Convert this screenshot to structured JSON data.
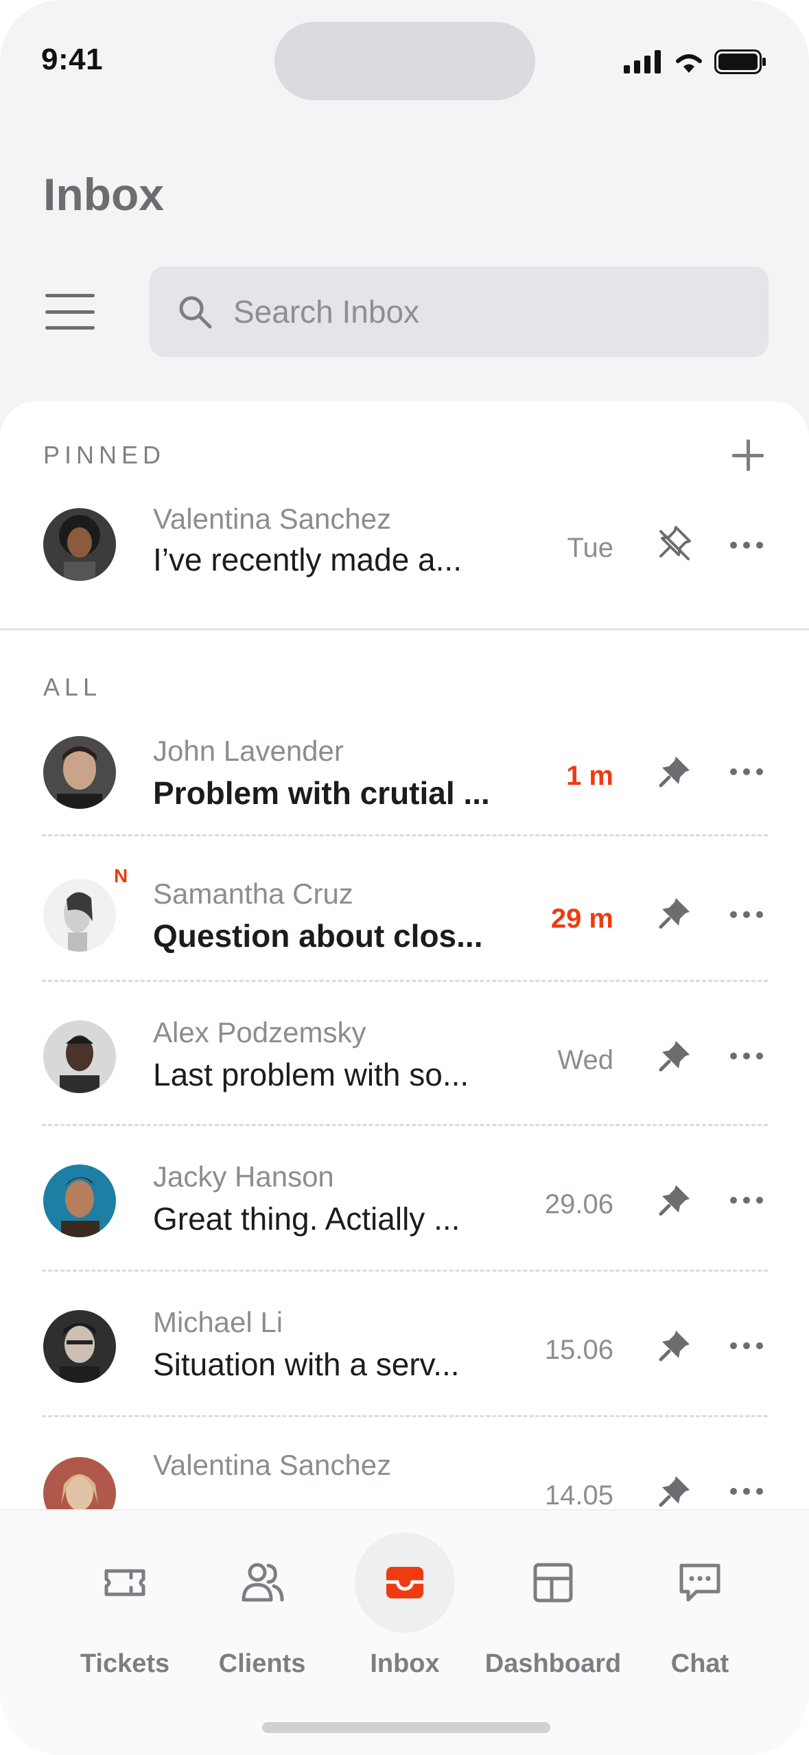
{
  "status_bar": {
    "time": "9:41"
  },
  "header": {
    "title": "Inbox"
  },
  "search": {
    "placeholder": "Search Inbox"
  },
  "sections": {
    "pinned": "PINNED",
    "all": "ALL"
  },
  "pinned": [
    {
      "name": "Valentina Sanchez",
      "message": "I’ve recently made a...",
      "time": "Tue",
      "pin_state": "unpin"
    }
  ],
  "all": [
    {
      "name": "John Lavender",
      "message": "Problem with crutial ...",
      "time": "1 m",
      "urgent": true,
      "badge": ""
    },
    {
      "name": "Samantha Cruz",
      "message": "Question about clos...",
      "time": "29 m",
      "urgent": true,
      "badge": "N"
    },
    {
      "name": "Alex Podzemsky",
      "message": "Last problem with so...",
      "time": "Wed",
      "urgent": false,
      "badge": ""
    },
    {
      "name": "Jacky Hanson",
      "message": "Great thing. Actially ...",
      "time": "29.06",
      "urgent": false,
      "badge": ""
    },
    {
      "name": "Michael Li",
      "message": "Situation with a serv...",
      "time": "15.06",
      "urgent": false,
      "badge": ""
    },
    {
      "name": "Valentina Sanchez",
      "message": "",
      "time": "14.05",
      "urgent": false,
      "badge": ""
    }
  ],
  "tabs": [
    {
      "label": "Tickets",
      "icon": "ticket-icon"
    },
    {
      "label": "Clients",
      "icon": "users-icon"
    },
    {
      "label": "Inbox",
      "icon": "inbox-icon",
      "active": true
    },
    {
      "label": "Dashboard",
      "icon": "dashboard-icon"
    },
    {
      "label": "Chat",
      "icon": "chat-icon"
    }
  ],
  "colors": {
    "accent": "#ef3b10",
    "muted": "#8a8d91",
    "background": "#f3f4f6"
  }
}
